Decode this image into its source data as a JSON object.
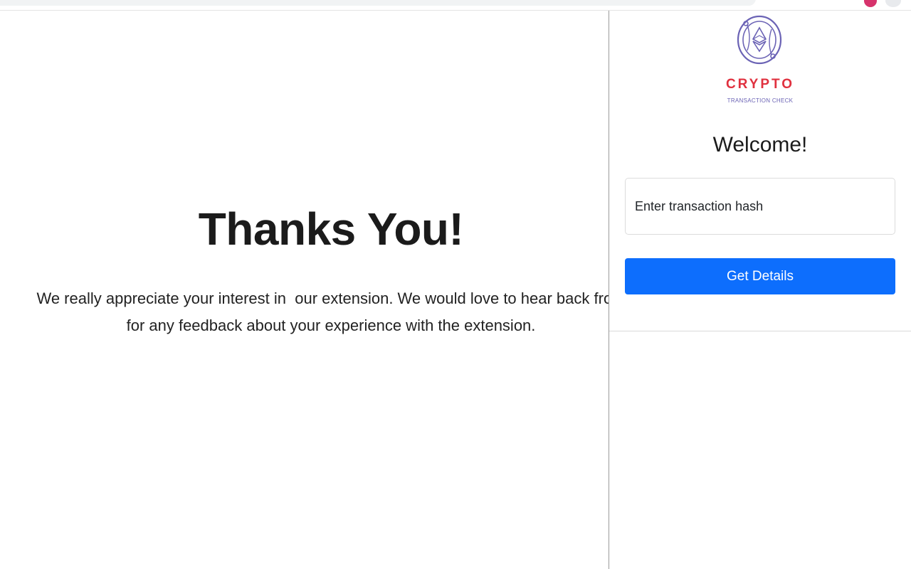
{
  "thanks": {
    "title": "Thanks You!",
    "message_line1": "We really appreciate your interest in  our extension. We would love to hear back from",
    "message_line2": "for any feedback about your experience with the extension."
  },
  "popup": {
    "logo_icon": "ethereum-coin-icon",
    "brand_name": "CRYPTO",
    "brand_tagline": "TRANSACTION CHECK",
    "welcome": "Welcome!",
    "hash_input": {
      "placeholder": "Enter transaction hash",
      "value": ""
    },
    "button_label": "Get Details"
  },
  "colors": {
    "brand_red": "#e0313f",
    "logo_purple": "#6b63b5",
    "button_blue": "#0d6efd"
  }
}
